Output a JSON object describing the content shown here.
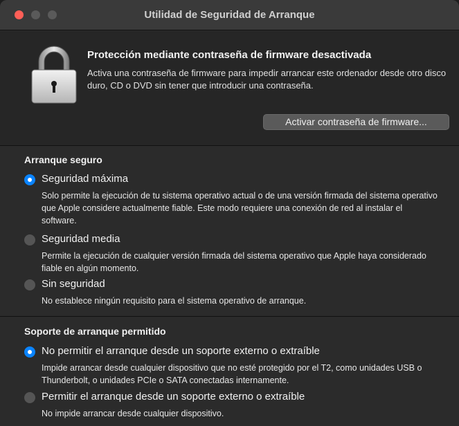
{
  "window": {
    "title": "Utilidad de Seguridad de Arranque"
  },
  "firmware": {
    "icon": "lock-icon",
    "heading": "Protección mediante contraseña de firmware desactivada",
    "description": "Activa una contraseña de firmware para impedir arrancar este ordenador desde otro disco duro, CD o DVD sin tener que introducir una contraseña.",
    "button_label": "Activar contraseña de firmware..."
  },
  "secure_boot": {
    "title": "Arranque seguro",
    "options": [
      {
        "label": "Seguridad máxima",
        "description": "Solo permite la ejecución de tu sistema operativo actual o de una versión firmada del sistema operativo que Apple considere actualmente fiable. Este modo requiere una conexión de red al instalar el software.",
        "selected": true
      },
      {
        "label": "Seguridad media",
        "description": "Permite la ejecución de cualquier versión firmada del sistema operativo que Apple haya considerado fiable en algún momento.",
        "selected": false
      },
      {
        "label": "Sin seguridad",
        "description": "No establece ningún requisito para el sistema operativo de arranque.",
        "selected": false
      }
    ]
  },
  "allowed_media": {
    "title": "Soporte de arranque permitido",
    "options": [
      {
        "label": "No permitir el arranque desde un soporte externo o extraíble",
        "description": "Impide arrancar desde cualquier dispositivo que no esté protegido por el T2, como unidades USB o Thunderbolt, o unidades PCIe o SATA conectadas internamente.",
        "selected": true
      },
      {
        "label": "Permitir el arranque desde un soporte externo o extraíble",
        "description": "No impide arrancar desde cualquier dispositivo.",
        "selected": false
      }
    ]
  },
  "colors": {
    "accent": "#0a84ff",
    "close_button": "#ff5f57",
    "background": "#2b2b2b"
  }
}
